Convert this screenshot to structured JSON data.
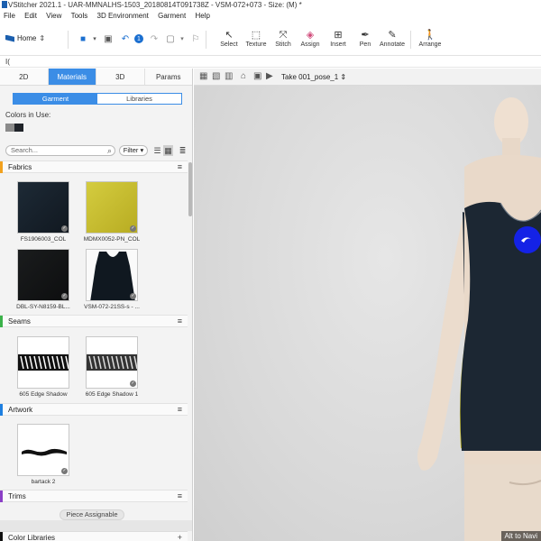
{
  "title_bar": {
    "text": "VStitcher 2021.1 - UAR-MMNALHS-1503_20180814T091738Z - VSM-072+073 - Size: (M) *"
  },
  "menu": [
    "File",
    "Edit",
    "View",
    "Tools",
    "3D Environment",
    "Garment",
    "Help"
  ],
  "toolbar": {
    "home_label": "Home",
    "tools": [
      {
        "label": "Select",
        "icon": "select-icon"
      },
      {
        "label": "Texture",
        "icon": "texture-icon"
      },
      {
        "label": "Stitch",
        "icon": "stitch-icon"
      },
      {
        "label": "Assign",
        "icon": "assign-icon"
      },
      {
        "label": "Insert",
        "icon": "insert-icon"
      },
      {
        "label": "Pen",
        "icon": "pen-icon"
      },
      {
        "label": "Annotate",
        "icon": "annotate-icon"
      },
      {
        "label": "Arrange",
        "icon": "arrange-icon"
      }
    ],
    "undo_badge": "1"
  },
  "strip": {
    "text": "I("
  },
  "left_panel": {
    "tabs": [
      "2D",
      "Materials",
      "3D",
      "Params"
    ],
    "active_tab": "Materials",
    "subtabs": [
      "Garment",
      "Libraries"
    ],
    "active_subtab": "Garment",
    "colors_label": "Colors in Use:",
    "colors": [
      "#8a8a8a",
      "#1f2329"
    ],
    "search_placeholder": "Search...",
    "filter_label": "Filter",
    "sections": {
      "fabrics": {
        "label": "Fabrics",
        "color": "#f2a11e"
      },
      "seams": {
        "label": "Seams",
        "color": "#3cb24a"
      },
      "artwork": {
        "label": "Artwork",
        "color": "#1e7fe0"
      },
      "trims": {
        "label": "Trims",
        "color": "#8b3fc6"
      }
    },
    "fabrics": [
      "FS1906003_COL",
      "MDMX0052-PN_COL",
      "DBL-SY-N8159-BL...",
      "VSM-072-21SS-s - ..."
    ],
    "seams": [
      "605 Edge Shadow",
      "605 Edge Shadow 1"
    ],
    "artwork": [
      "bartack 2"
    ],
    "piece_assignable": "Piece Assignable",
    "color_libraries": "Color Libraries"
  },
  "viewport": {
    "take_label": "Take 001_pose_1",
    "nav_hint": "Alt to Navi"
  }
}
